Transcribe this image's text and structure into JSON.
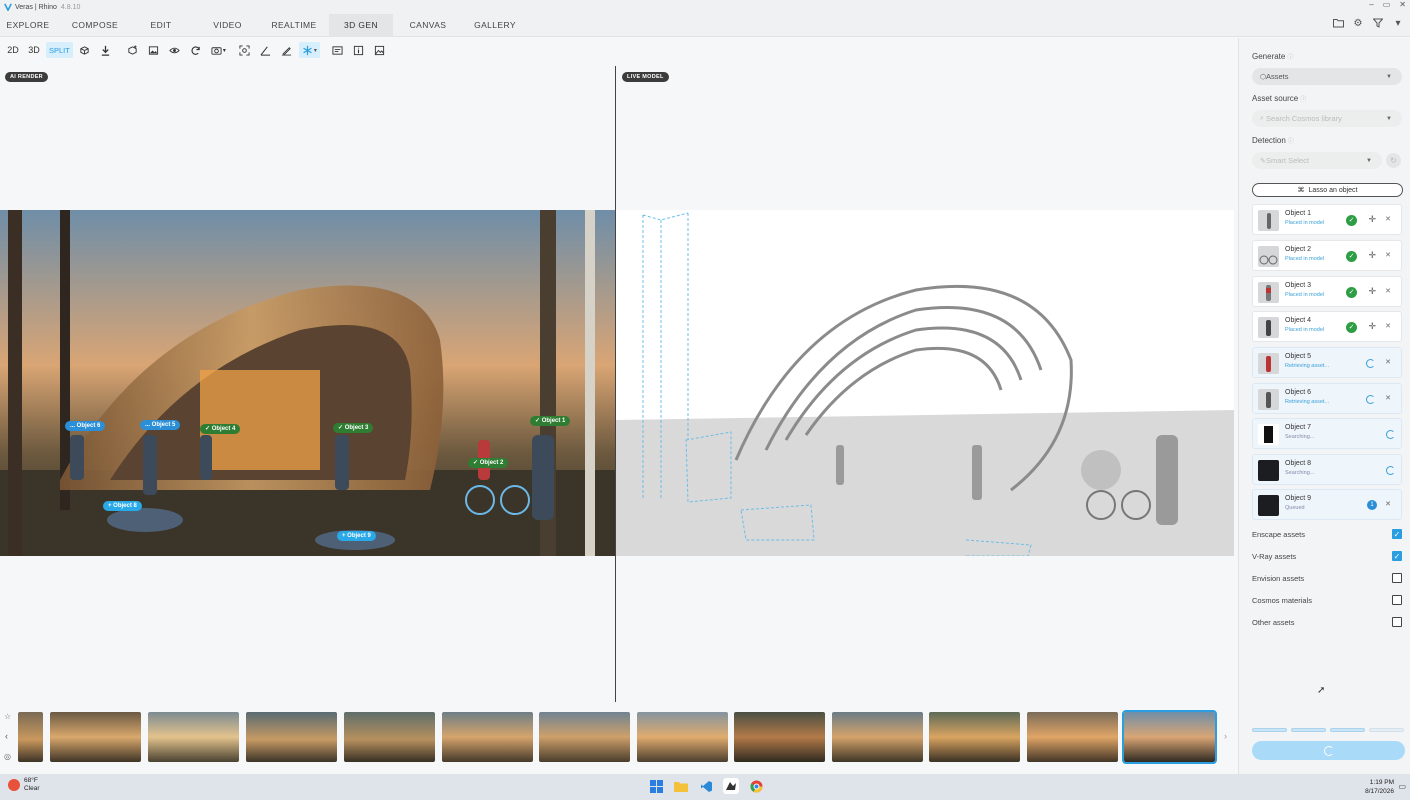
{
  "window": {
    "title": "Veras | Rhino",
    "version": "4.8.10"
  },
  "menu": {
    "tabs": [
      "EXPLORE",
      "COMPOSE",
      "EDIT",
      "VIDEO",
      "REALTIME",
      "3D GEN",
      "CANVAS",
      "GALLERY"
    ],
    "active_tab": "3D GEN"
  },
  "toolbar": {
    "btn_2d": "2D",
    "btn_3d": "3D",
    "btn_split": "SPLIT",
    "icons": [
      "cube-frame-icon",
      "download-icon",
      "add-box-icon",
      "image-icon",
      "eye-icon",
      "sync-icon",
      "camera-icon",
      "focus-icon",
      "angle-icon",
      "pen-angle-icon",
      "snowflake-icon",
      "layout-icon",
      "info-box-icon",
      "gallery-icon"
    ]
  },
  "viewport": {
    "left_label": "AI RENDER",
    "right_label": "LIVE MODEL"
  },
  "render_tags": [
    {
      "label": "... Object 6",
      "state": "pending"
    },
    {
      "label": "... Object 5",
      "state": "pending"
    },
    {
      "label": "✓ Object 4",
      "state": "placed"
    },
    {
      "label": "✓ Object 3",
      "state": "placed"
    },
    {
      "label": "✓ Object 1",
      "state": "placed"
    },
    {
      "label": "✓ Object 2",
      "state": "placed"
    },
    {
      "label": "+ Object 8",
      "state": "queued"
    },
    {
      "label": "+ Object 9",
      "state": "queued"
    }
  ],
  "sidebar": {
    "generate_label": "Generate",
    "generate_value": "Assets",
    "asset_source_label": "Asset source",
    "asset_source_placeholder": "Search Cosmos library",
    "detection_label": "Detection",
    "detection_value": "Smart Select",
    "lasso_button": "Lasso an object",
    "objects": [
      {
        "name": "Object 1",
        "status": "Placed in model",
        "state": "placed"
      },
      {
        "name": "Object 2",
        "status": "Placed in model",
        "state": "placed"
      },
      {
        "name": "Object 3",
        "status": "Placed in model",
        "state": "placed"
      },
      {
        "name": "Object 4",
        "status": "Placed in model",
        "state": "placed"
      },
      {
        "name": "Object 5",
        "status": "Retrieving asset...",
        "state": "retrieving"
      },
      {
        "name": "Object 6",
        "status": "Retrieving asset...",
        "state": "retrieving"
      },
      {
        "name": "Object 7",
        "status": "Searching...",
        "state": "searching"
      },
      {
        "name": "Object 8",
        "status": "Searching...",
        "state": "searching"
      },
      {
        "name": "Object 9",
        "status": "Queued",
        "state": "queued",
        "queue_position": "1"
      }
    ],
    "asset_filters": [
      {
        "label": "Enscape assets",
        "checked": true
      },
      {
        "label": "V-Ray assets",
        "checked": true
      },
      {
        "label": "Envision assets",
        "checked": false
      },
      {
        "label": "Cosmos materials",
        "checked": false
      },
      {
        "label": "Other assets",
        "checked": false
      }
    ]
  },
  "taskbar": {
    "temperature": "68°F",
    "weather": "Clear",
    "time": "1:19 PM",
    "date": "8/17/2026"
  },
  "colors": {
    "accent": "#2a9ee0",
    "placed": "#2e7d32",
    "tag_blue": "#2b8fd8"
  }
}
